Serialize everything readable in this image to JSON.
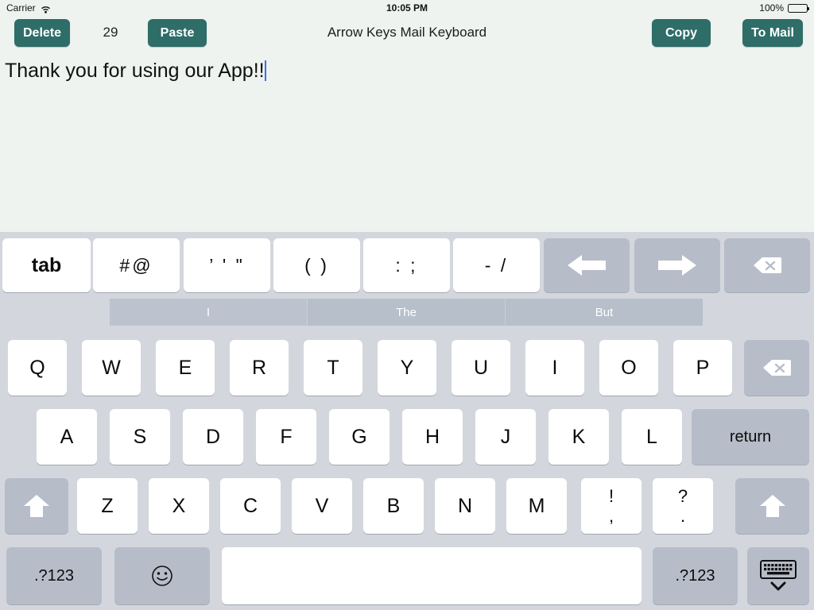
{
  "status_bar": {
    "carrier": "Carrier",
    "wifi_icon": "wifi-icon",
    "time": "10:05 PM",
    "battery_percent": "100%",
    "battery_icon": "battery-full-icon"
  },
  "toolbar": {
    "delete_label": "Delete",
    "counter": "29",
    "paste_label": "Paste",
    "title": "Arrow Keys Mail Keyboard",
    "copy_label": "Copy",
    "to_mail_label": "To Mail",
    "button_color": "#2e6d68"
  },
  "editor": {
    "text": "Thank you for using our App!!",
    "caret_color": "#3b6ef0",
    "background": "#eef3f0"
  },
  "keyboard": {
    "background": "#d3d7dd",
    "function_row": [
      {
        "label": "tab",
        "name": "key-tab",
        "style": "light"
      },
      {
        "label": "#@",
        "name": "key-hash-at",
        "style": "light"
      },
      {
        "label": "’ ' \"",
        "name": "key-quotes",
        "style": "light"
      },
      {
        "label": "( )",
        "name": "key-parentheses",
        "style": "light"
      },
      {
        "label": ": ;",
        "name": "key-colon-semicolon",
        "style": "light"
      },
      {
        "label": "- /",
        "name": "key-dash-slash",
        "style": "light"
      },
      {
        "label": "",
        "name": "key-arrow-left",
        "style": "dark",
        "icon": "arrow-left-icon"
      },
      {
        "label": "",
        "name": "key-arrow-right",
        "style": "dark",
        "icon": "arrow-right-icon"
      },
      {
        "label": "",
        "name": "key-backspace-top",
        "style": "dark",
        "icon": "backspace-icon"
      }
    ],
    "suggestions": [
      "I",
      "The",
      "But"
    ],
    "row_1": [
      "Q",
      "W",
      "E",
      "R",
      "T",
      "Y",
      "U",
      "I",
      "O",
      "P"
    ],
    "row_1_backspace": {
      "name": "key-backspace",
      "icon": "backspace-icon"
    },
    "row_2": [
      "A",
      "S",
      "D",
      "F",
      "G",
      "H",
      "J",
      "K",
      "L"
    ],
    "return_label": "return",
    "row_3": [
      "Z",
      "X",
      "C",
      "V",
      "B",
      "N",
      "M"
    ],
    "row_3_punct": [
      {
        "upper": "!",
        "lower": ",",
        "name": "key-exclamation-comma"
      },
      {
        "upper": "?",
        "lower": ".",
        "name": "key-question-period"
      }
    ],
    "shift_left": {
      "name": "key-shift-left",
      "icon": "shift-arrow-up-icon"
    },
    "shift_right": {
      "name": "key-shift-right",
      "icon": "shift-arrow-up-icon"
    },
    "numeric_left_label": ".?123",
    "emoji_icon": "emoji-smiley-icon",
    "space_label": "",
    "numeric_right_label": ".?123",
    "hide_keyboard_icon": "hide-keyboard-icon"
  }
}
